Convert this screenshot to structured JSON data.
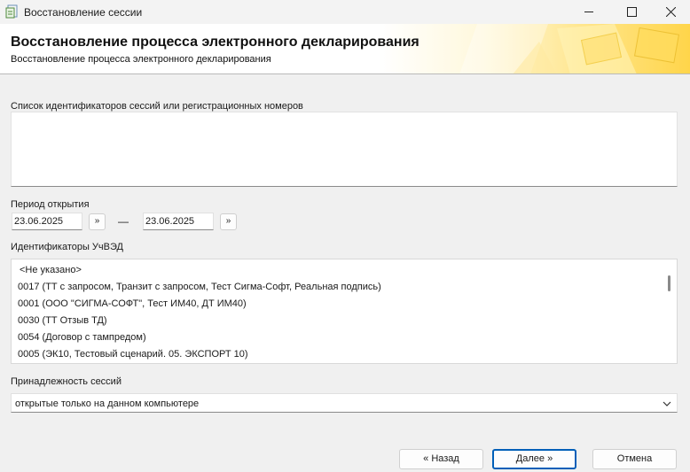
{
  "window": {
    "title": "Восстановление сессии",
    "icon": "app-document-icon",
    "controls": [
      "minimize-icon",
      "maximize-icon",
      "close-icon"
    ]
  },
  "banner": {
    "title": "Восстановление процесса электронного декларирования",
    "subtitle": "Восстановление процесса электронного декларирования"
  },
  "sessions": {
    "label": "Список идентификаторов сессий или регистрационных номеров",
    "value": ""
  },
  "period": {
    "label": "Период открытия",
    "from": "23.06.2025",
    "to": "23.06.2025",
    "picker_label": "»",
    "separator": "—"
  },
  "uvd": {
    "label": "Идентификаторы УчВЭД",
    "items": [
      "<Не указано>",
      "0017 (ТТ с запросом, Транзит с запросом, Тест Сигма-Софт, Реальная подпись)",
      "0001 (ООО \"СИГМА-СОФТ\", Тест ИМ40, ДТ ИМ40)",
      "0030 (ТТ Отзыв ТД)",
      "0054 (Договор с тампредом)",
      "0005 (ЭК10, Тестовый сценарий. 05. ЭКСПОРТ 10)"
    ]
  },
  "ownership": {
    "label": "Принадлежность сессий",
    "selected": "открытые только на данном компьютере"
  },
  "buttons": {
    "back": "« Назад",
    "next": "Далее »",
    "cancel": "Отмена"
  },
  "colors": {
    "accent": "#005fb8",
    "banner_gold": "#ffd54a"
  }
}
